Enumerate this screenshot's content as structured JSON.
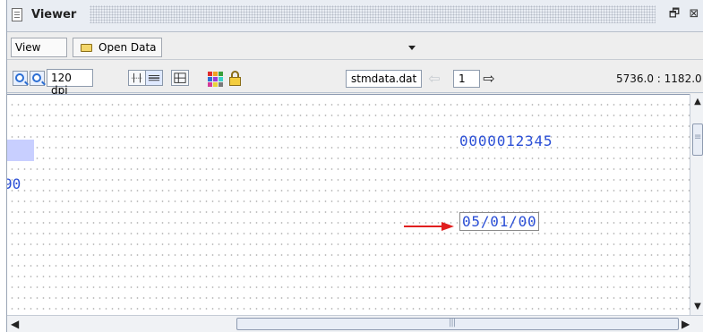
{
  "window": {
    "title": "Viewer",
    "buttons": {
      "restore_icon": "restore-icon",
      "close_icon": "close-icon"
    }
  },
  "toolbar1": {
    "view_label": "View",
    "open_data_label": "Open Data"
  },
  "toolbar2": {
    "dpi": "120 dpi",
    "file_name": "stmdata.dat",
    "page": "1",
    "coordinates": "5736.0 : 1182.0"
  },
  "canvas": {
    "field_a": "0000012345",
    "field_b": "90",
    "field_c": "05/01/00"
  },
  "colors": {
    "field_text": "#2b4fd6",
    "highlight": "#c8cfff",
    "arrow": "#e11f1f"
  }
}
